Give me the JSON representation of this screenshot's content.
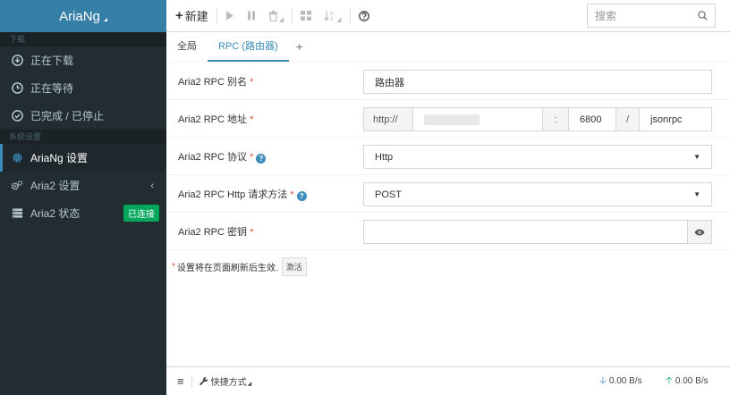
{
  "app": {
    "title": "AriaNg"
  },
  "sidebar": {
    "section_download": "下载",
    "section_settings": "系统设置",
    "items": [
      {
        "label": "正在下载",
        "icon": "arrow-circle-down-icon"
      },
      {
        "label": "正在等待",
        "icon": "clock-icon"
      },
      {
        "label": "已完成 / 已停止",
        "icon": "check-circle-icon"
      },
      {
        "label": "AriaNg 设置",
        "icon": "gear-icon"
      },
      {
        "label": "Aria2 设置",
        "icon": "gears-icon"
      },
      {
        "label": "Aria2 状态",
        "icon": "server-icon",
        "badge": "已连接"
      }
    ]
  },
  "toolbar": {
    "new_label": "新建",
    "search_placeholder": "搜索"
  },
  "tabs": [
    {
      "label": "全局"
    },
    {
      "label": "RPC (路由器)"
    },
    {
      "label": "+"
    }
  ],
  "settings": {
    "alias": {
      "label": "Aria2 RPC 别名",
      "value": "路由器"
    },
    "address": {
      "label": "Aria2 RPC 地址",
      "protocol": "http://",
      "colon": ":",
      "port": "6800",
      "slash": "/",
      "path": "jsonrpc"
    },
    "protocol": {
      "label": "Aria2 RPC 协议",
      "value": "Http"
    },
    "method": {
      "label": "Aria2 RPC Http 请求方法",
      "value": "POST"
    },
    "secret": {
      "label": "Aria2 RPC 密钥",
      "value": ""
    },
    "required_mark": "*",
    "help_mark": "?"
  },
  "note": {
    "text": "设置将在页面刷新后生效.",
    "button": "激活"
  },
  "footer": {
    "shortcut_label": "快捷方式",
    "download_speed": "0.00 B/s",
    "upload_speed": "0.00 B/s"
  },
  "colors": {
    "accent": "#3c8dbc",
    "sidebar_bg": "#222d32",
    "connected": "#00a65a",
    "required": "#dd4b39"
  }
}
